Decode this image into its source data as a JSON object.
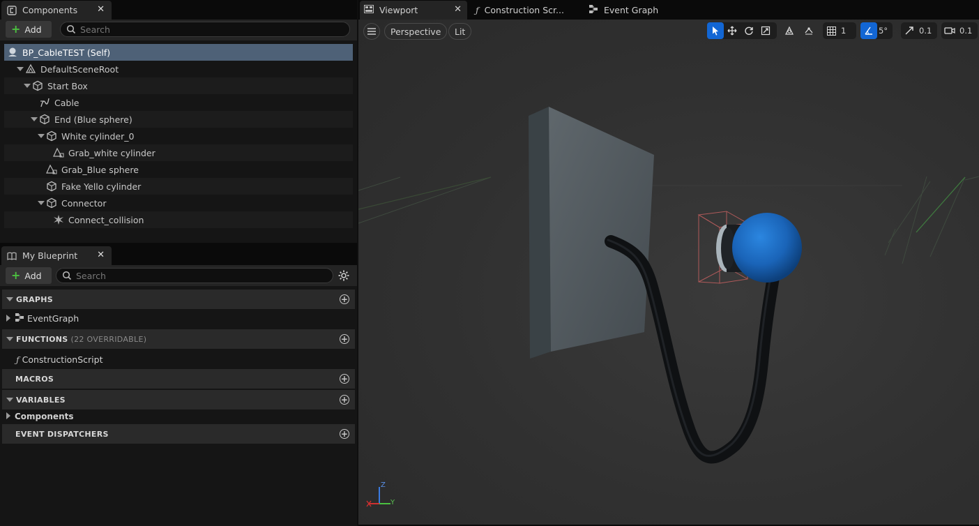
{
  "components_panel": {
    "tab_title": "Components",
    "add_label": "Add",
    "search_placeholder": "Search",
    "tree": [
      {
        "label": "BP_CableTEST (Self)",
        "icon": "blueprint-self-icon"
      },
      {
        "label": "DefaultSceneRoot",
        "icon": "scene-root-icon"
      },
      {
        "label": "Start Box",
        "icon": "static-mesh-icon"
      },
      {
        "label": "Cable",
        "icon": "cable-icon"
      },
      {
        "label": "End (Blue sphere)",
        "icon": "static-mesh-icon"
      },
      {
        "label": "White cylinder_0",
        "icon": "static-mesh-icon"
      },
      {
        "label": "Grab_white cylinder",
        "icon": "grab-component-icon"
      },
      {
        "label": "Grab_Blue sphere",
        "icon": "grab-component-icon"
      },
      {
        "label": "Fake Yello cylinder",
        "icon": "static-mesh-icon"
      },
      {
        "label": "Connector",
        "icon": "static-mesh-icon"
      },
      {
        "label": "Connect_collision",
        "icon": "collision-icon"
      }
    ]
  },
  "my_blueprint_panel": {
    "tab_title": "My Blueprint",
    "add_label": "Add",
    "search_placeholder": "Search",
    "sections": {
      "graphs": "GRAPHS",
      "functions": "FUNCTIONS",
      "functions_sub": "(22 OVERRIDABLE)",
      "macros": "MACROS",
      "variables": "VARIABLES",
      "dispatchers": "EVENT DISPATCHERS"
    },
    "items": {
      "event_graph": "EventGraph",
      "construction_script": "ConstructionScript",
      "components": "Components"
    }
  },
  "editor_tabs": {
    "viewport": "Viewport",
    "construction_script": "Construction Scr...",
    "event_graph": "Event Graph"
  },
  "viewport": {
    "view_mode": "Perspective",
    "lighting": "Lit",
    "grid_snap": "1",
    "rotation_snap": "5°",
    "scale_snap": "0.1",
    "camera_speed": "0.1",
    "axis_z": "Z",
    "axis_y": "Y"
  },
  "colors": {
    "accent": "#1266d4",
    "selected_row": "#4e6177",
    "sphere": "#1f6fc2",
    "add_plus": "#4cc040"
  }
}
